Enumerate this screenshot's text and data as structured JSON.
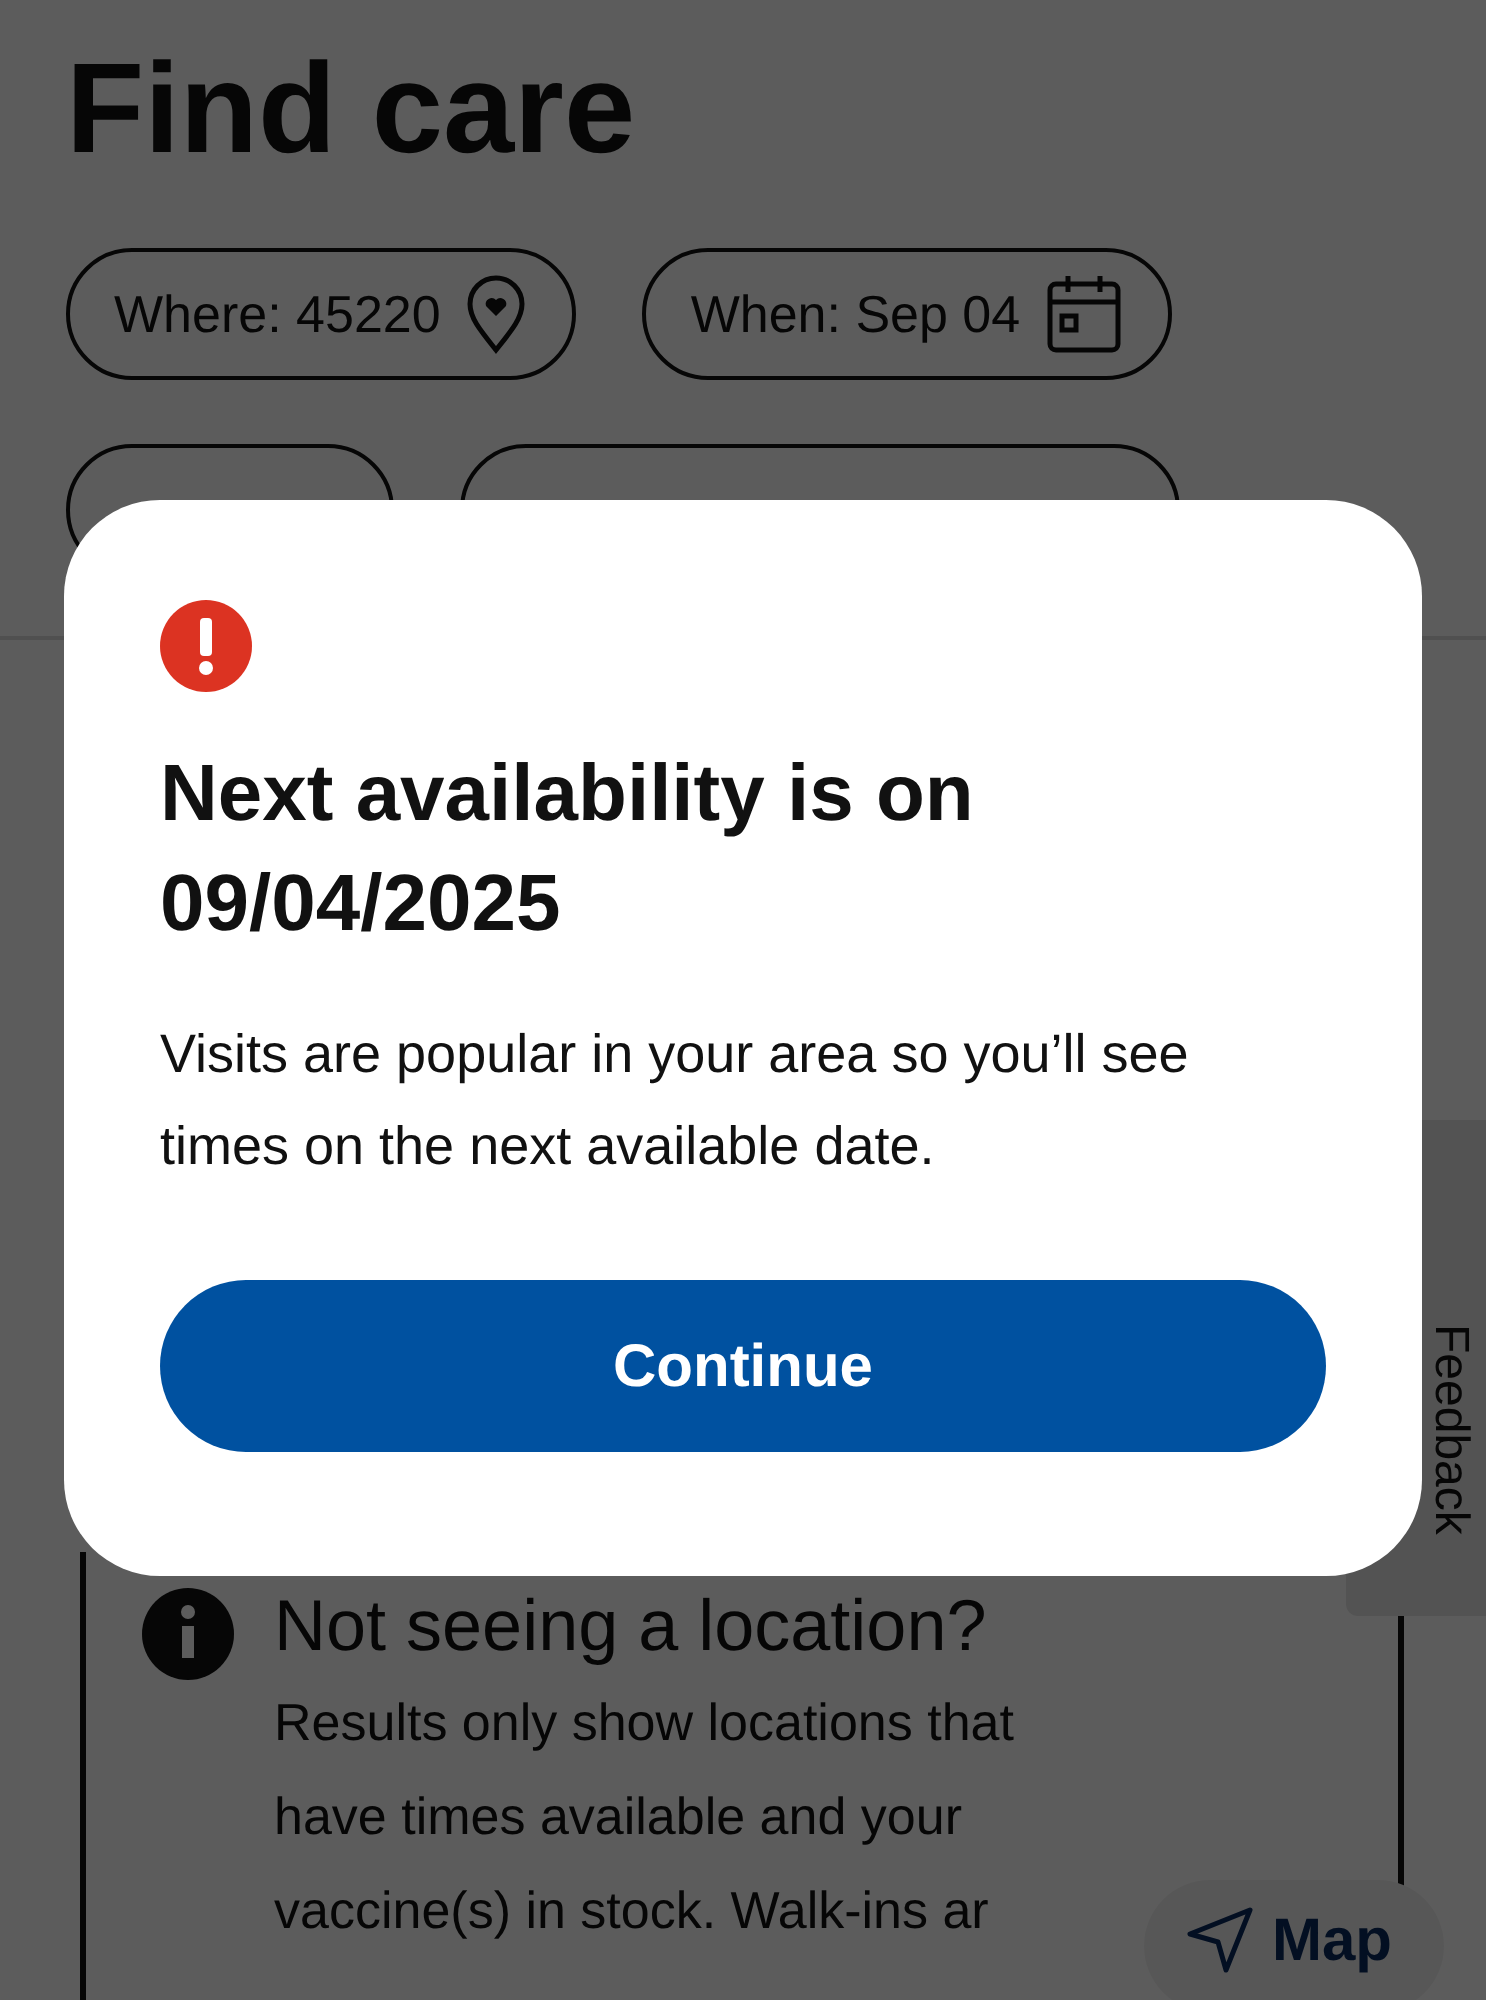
{
  "page": {
    "title": "Find care",
    "chips": [
      {
        "label": "Where: 45220",
        "kind": "location"
      },
      {
        "label": "When: Sep 04",
        "kind": "calendar"
      }
    ],
    "notice": {
      "title": "Not seeing a location?",
      "body": "Results only show locations that have times available and your vaccine(s) in stock. Walk-ins ar"
    },
    "feedback": "Feedback",
    "map_button": "Map"
  },
  "dialog": {
    "title": "Next availability is on 09/04/2025",
    "body": "Visits are popular in your area so you’ll see times on the next available date.",
    "button": "Continue"
  }
}
